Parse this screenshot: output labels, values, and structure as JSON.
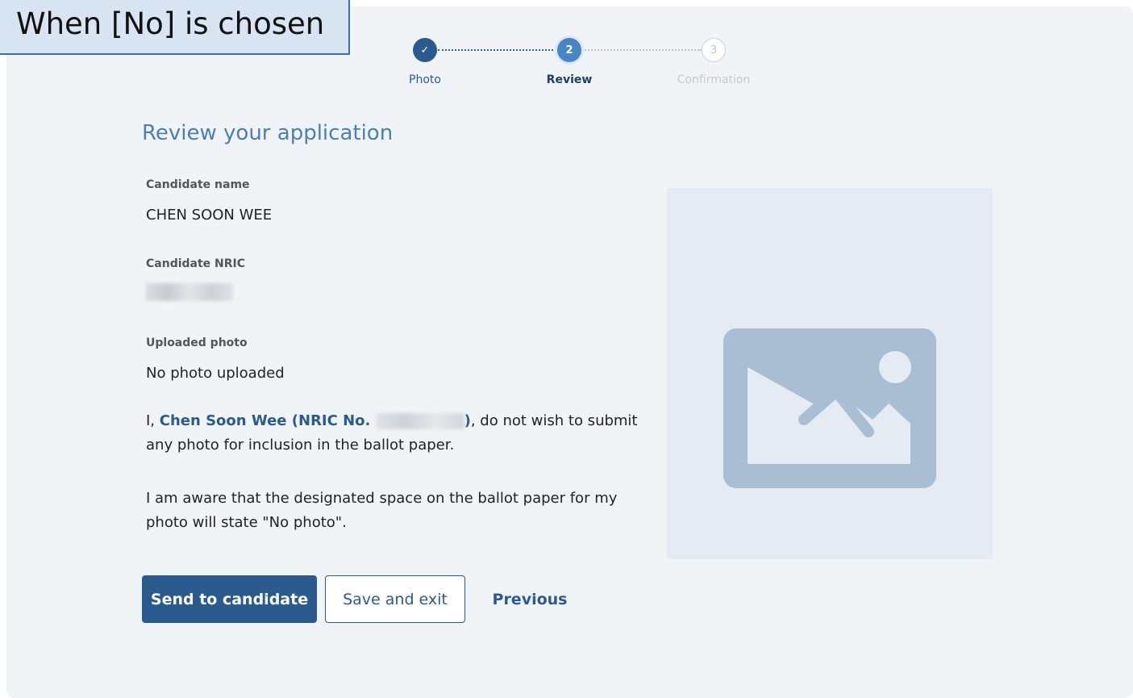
{
  "callout": {
    "text": "When [No] is chosen"
  },
  "stepper": {
    "steps": [
      {
        "label": "Photo",
        "marker": "✓",
        "state": "done"
      },
      {
        "label": "Review",
        "marker": "2",
        "state": "active"
      },
      {
        "label": "Confirmation",
        "marker": "3",
        "state": "pending"
      }
    ]
  },
  "page": {
    "title": "Review your application"
  },
  "fields": {
    "candidate_name_label": "Candidate name",
    "candidate_name_value": "CHEN SOON WEE",
    "candidate_nric_label": "Candidate NRIC",
    "uploaded_photo_label": "Uploaded photo",
    "uploaded_photo_value": "No photo uploaded"
  },
  "declaration": {
    "prefix": "I, ",
    "name_part": "Chen Soon Wee (NRIC No. ",
    "close_part": ")",
    "suffix": ", do not wish to submit any photo for inclusion in the ballot paper.",
    "aware_text": "I am aware that the designated space on the ballot paper for my photo will state \"No photo\"."
  },
  "photo_placeholder": {
    "icon": "image-placeholder-icon"
  },
  "actions": {
    "send_label": "Send to candidate",
    "save_label": "Save and exit",
    "previous_label": "Previous"
  },
  "colors": {
    "primary": "#2b5a8f",
    "active_step": "#4a86c5",
    "title": "#4a7fb8",
    "panel_bg": "#f1f4f7",
    "placeholder_bg": "#e4ebf2",
    "placeholder_icon": "#a9bdd3"
  }
}
